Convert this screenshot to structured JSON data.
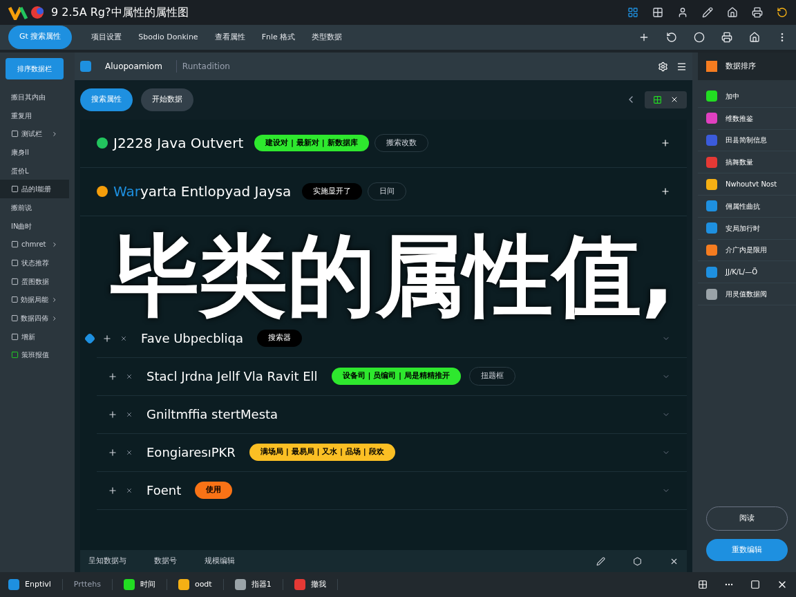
{
  "window": {
    "title": "9 2.5A Rg?中属性的属性图"
  },
  "nav": {
    "tabs": [
      {
        "label": "Gt 搜索属性",
        "selected": true
      },
      {
        "label": "项目设置",
        "selected": false
      },
      {
        "label": "Sbodio Donkine",
        "selected": false
      },
      {
        "label": "查看属性",
        "selected": false
      },
      {
        "label": "Fnle 格式",
        "selected": false
      },
      {
        "label": "类型数据",
        "selected": false
      }
    ]
  },
  "sidebar": {
    "button": "排序数据栏",
    "items": [
      {
        "label": "搬目其内由",
        "kind": "plain",
        "has_submenu": false,
        "selected": false
      },
      {
        "label": "重复用",
        "kind": "plain",
        "has_submenu": false,
        "selected": false
      },
      {
        "label": "测试栏",
        "kind": "icon",
        "has_submenu": true,
        "selected": false
      },
      {
        "label": "康身II",
        "kind": "plain",
        "has_submenu": false,
        "selected": false
      },
      {
        "label": "蛋价L",
        "kind": "plain",
        "has_submenu": false,
        "selected": false
      },
      {
        "label": "品的I能册",
        "kind": "icon",
        "has_submenu": false,
        "selected": true
      },
      {
        "label": "搬前说",
        "kind": "plain",
        "has_submenu": false,
        "selected": false
      },
      {
        "label": "IN曲时",
        "kind": "plain",
        "has_submenu": false,
        "selected": false
      },
      {
        "label": "chmret",
        "kind": "icon",
        "has_submenu": true,
        "selected": false
      },
      {
        "label": "状态推荐",
        "kind": "icon",
        "has_submenu": false,
        "selected": false
      },
      {
        "label": "蛋图数据",
        "kind": "icon",
        "has_submenu": false,
        "selected": false
      },
      {
        "label": "効据局能",
        "kind": "icon",
        "has_submenu": true,
        "selected": false
      },
      {
        "label": "数据四佈",
        "kind": "icon",
        "has_submenu": true,
        "selected": false
      },
      {
        "label": "增新",
        "kind": "icon",
        "has_submenu": false,
        "selected": false
      },
      {
        "label": "策班报值",
        "kind": "check",
        "has_submenu": false,
        "selected": false
      }
    ]
  },
  "main": {
    "header": {
      "tabs": [
        {
          "label": "Aluopoamiom",
          "selected": true
        },
        {
          "label": "Runtadition",
          "selected": false
        }
      ]
    },
    "buttons": [
      {
        "label": "搜索属性",
        "kind": "primary"
      },
      {
        "label": "开始数据",
        "kind": "secondary"
      }
    ],
    "view_toggle": {
      "on": true
    },
    "rows": [
      {
        "kind": "heading",
        "title": "J2228 Java Outvert",
        "color": "#22c55e",
        "tags": [
          {
            "label": "建设对 | 最新对 | 新数据库",
            "kind": "filled",
            "color": "#2ee82e"
          },
          {
            "label": "搬索改数",
            "kind": "outline"
          }
        ]
      },
      {
        "kind": "heading",
        "title_accent": "War",
        "title": "yarta Entlopyad Jaysa",
        "color": "#f59e0b",
        "tags": [
          {
            "label": "实施显开了",
            "kind": "dark"
          },
          {
            "label": "日间",
            "kind": "outline"
          }
        ]
      },
      {
        "kind": "item",
        "title": "Fave Ubpecbliqa",
        "color": "#1e90e0",
        "tags": [
          {
            "label": "搜索器",
            "kind": "dark"
          }
        ]
      },
      {
        "kind": "item",
        "title": "Stacl Jrdna Jellf Vla Ravit Ell",
        "tags": [
          {
            "label": "设备司 | 员编司 | 局是精精推开",
            "kind": "filled",
            "color": "#2ee82e"
          },
          {
            "label": "扭题框",
            "kind": "outline"
          }
        ]
      },
      {
        "kind": "item",
        "title": "Gniltmffia stertMesta",
        "tags": []
      },
      {
        "kind": "item",
        "title": "EongiaresıPKR",
        "tags": [
          {
            "label": "满场局 | 最易局 | 又水 | 品场 | 段欢",
            "kind": "filled",
            "color": "#fbbf24"
          }
        ]
      },
      {
        "kind": "item",
        "title": "Foent",
        "tags": [
          {
            "label": "使用",
            "kind": "filled",
            "color": "#f97316"
          }
        ]
      }
    ],
    "footer": [
      "呈知数据与",
      "数据号",
      "规模编辑"
    ],
    "caption": "毕类的属性值,"
  },
  "right_panel": {
    "title": "数据排序",
    "items": [
      {
        "label": "加中",
        "color": "#22dd22"
      },
      {
        "label": "维数推鉴",
        "color": "#e040c0"
      },
      {
        "label": "田县简制信息",
        "color": "#3b5bdb"
      },
      {
        "label": "搞舞数量",
        "color": "#e53935"
      },
      {
        "label": "Nwhoutvt Nost",
        "color": "#f5b014"
      },
      {
        "label": "佣属性曲抗",
        "color": "#1e90e0"
      },
      {
        "label": "安局加行时",
        "color": "#1e90e0"
      },
      {
        "label": "介广内是限用",
        "color": "#f57c20"
      },
      {
        "label": "JJ/K/L/—Ö",
        "color": "#1e90e0"
      },
      {
        "label": "用灵值数据阅",
        "color": "#9aa3a8"
      }
    ],
    "buttons": [
      {
        "label": "阅读",
        "kind": "secondary"
      },
      {
        "label": "重数编辑",
        "kind": "primary"
      }
    ]
  },
  "taskbar": {
    "items": [
      {
        "label": "Enptivl",
        "color": "#1e90e0"
      },
      {
        "label": "Prttehs"
      },
      {
        "label": "时间",
        "color": "#22dd22"
      },
      {
        "label": "oodt",
        "color": "#f5b014"
      },
      {
        "label": "指器1",
        "color": "#9aa3a8"
      },
      {
        "label": "撤我",
        "color": "#e53935"
      }
    ]
  }
}
